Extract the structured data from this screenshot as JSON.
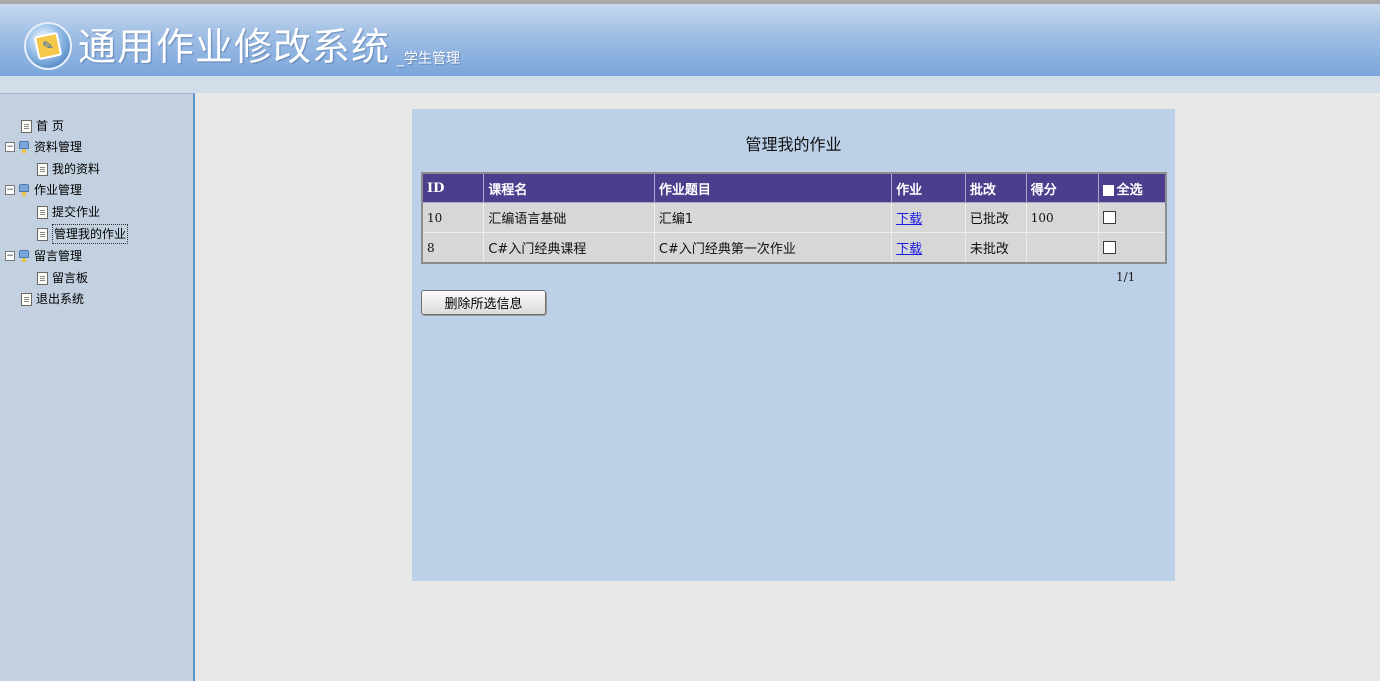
{
  "header": {
    "title": "通用作业修改系统",
    "subtitle": "_学生管理"
  },
  "sidebar": {
    "items": [
      {
        "label": "首 页",
        "type": "page",
        "level": 0
      },
      {
        "label": "资料管理",
        "type": "folder",
        "level": 0
      },
      {
        "label": "我的资料",
        "type": "page",
        "level": 1
      },
      {
        "label": "作业管理",
        "type": "folder",
        "level": 0
      },
      {
        "label": "提交作业",
        "type": "page",
        "level": 1
      },
      {
        "label": "管理我的作业",
        "type": "page",
        "level": 1,
        "current": true
      },
      {
        "label": "留言管理",
        "type": "folder",
        "level": 0
      },
      {
        "label": "留言板",
        "type": "page",
        "level": 1
      },
      {
        "label": "退出系统",
        "type": "page",
        "level": 0
      }
    ],
    "expander_symbol": "−"
  },
  "main": {
    "title": "管理我的作业",
    "table": {
      "columns": [
        "ID",
        "课程名",
        "作业题目",
        "作业",
        "批改",
        "得分",
        "全选"
      ],
      "rows": [
        {
          "id": "10",
          "course": "汇编语言基础",
          "topic": "汇编1",
          "file": "下载",
          "status": "已批改",
          "score": "100"
        },
        {
          "id": "8",
          "course": "C#入门经典课程",
          "topic": "C#入门经典第一次作业",
          "file": "下载",
          "status": "未批改",
          "score": ""
        }
      ]
    },
    "pager": "1/1",
    "delete_button": "删除所选信息"
  },
  "colors": {
    "header_bg": "#7ba6db",
    "sidebar_bg": "#c2d0df",
    "panel_bg": "#bcd0e7",
    "table_header_bg": "#4c3d8d",
    "link": "#1a1ae6"
  }
}
